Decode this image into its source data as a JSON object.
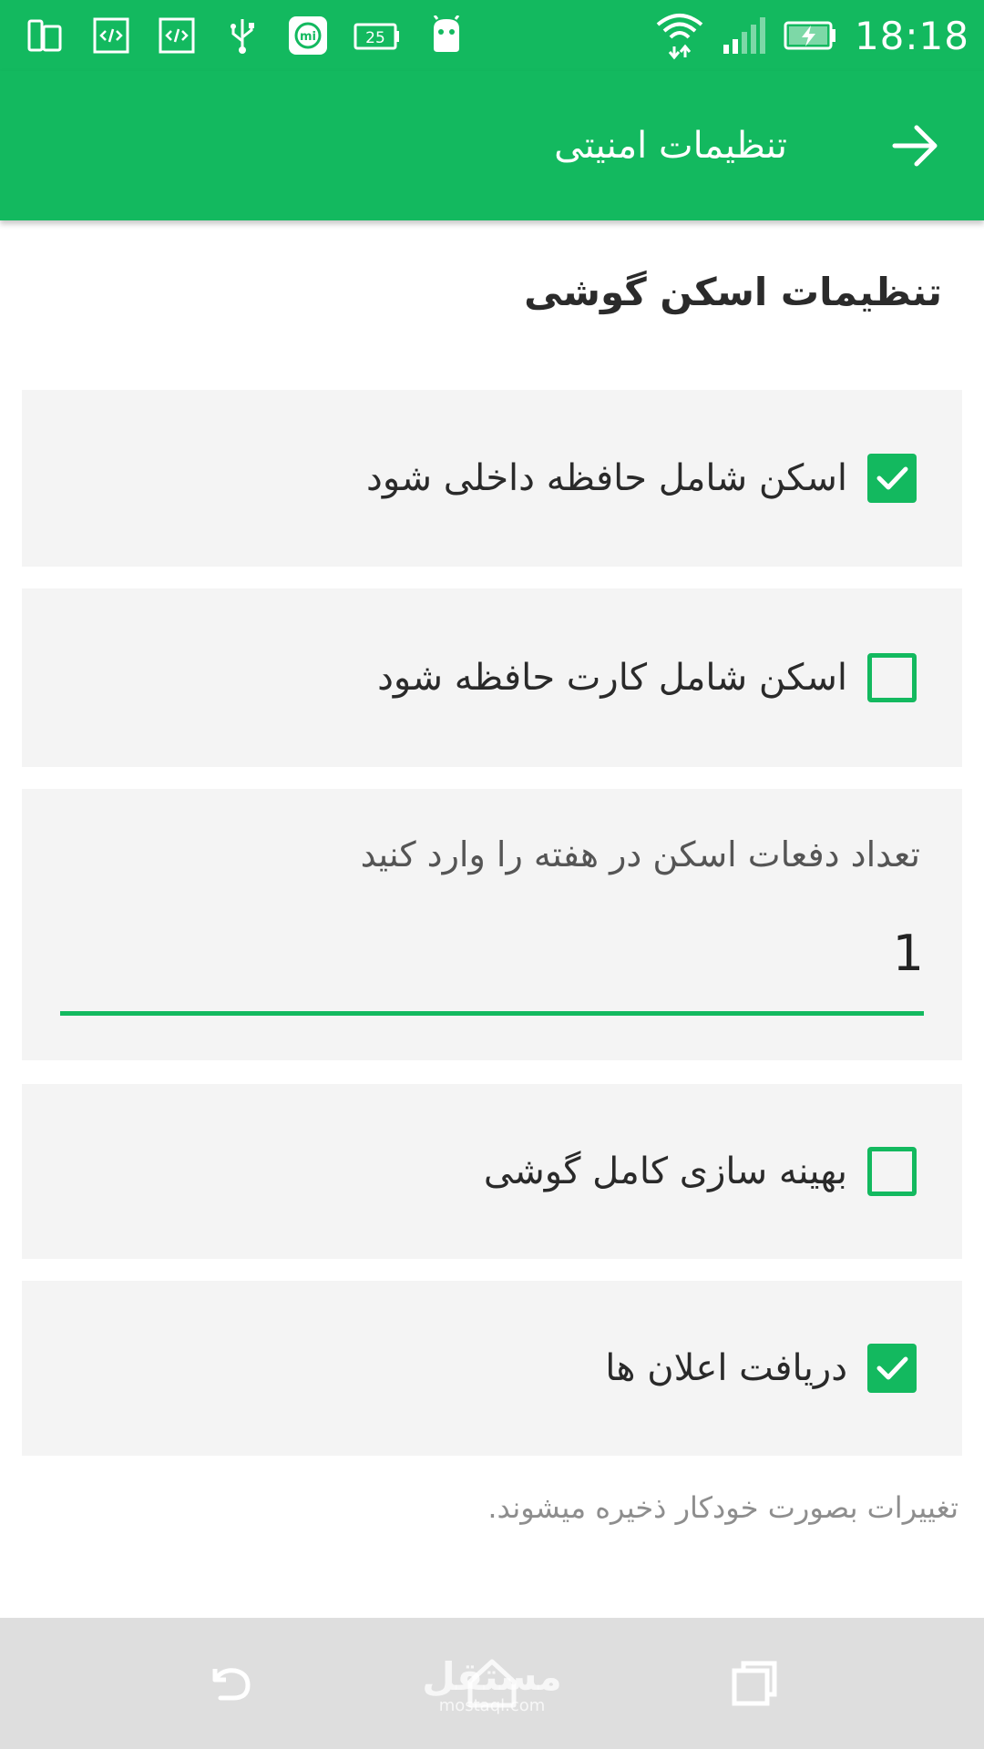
{
  "status_bar": {
    "time": "18:18",
    "battery_badge": "25",
    "mi_badge": "mi",
    "left_icons": [
      "phone-sync-icon",
      "developer-code-icon",
      "developer-code-icon",
      "usb-icon",
      "mi-icon",
      "battery-25-icon",
      "android-icon"
    ],
    "right_icons": [
      "wifi-icon",
      "signal-icon",
      "battery-charging-icon"
    ]
  },
  "app_bar": {
    "title": "تنظیمات امنیتی",
    "back_icon": "arrow-right-icon"
  },
  "section": {
    "title": "تنظیمات اسکن گوشی"
  },
  "settings": {
    "internal_memory": {
      "label": "اسکن شامل حافظه داخلی شود",
      "checked": true
    },
    "memory_card": {
      "label": "اسکن شامل کارت حافظه شود",
      "checked": false
    },
    "scan_count": {
      "label": "تعداد دفعات اسکن در هفته را وارد کنید",
      "value": "1"
    },
    "full_optimization": {
      "label": "بهینه سازی کامل گوشی",
      "checked": false
    },
    "notifications": {
      "label": "دریافت اعلان ها",
      "checked": true
    }
  },
  "footer": {
    "note": "تغییرات بصورت خودکار ذخیره میشوند."
  },
  "nav_bar": {
    "icons": [
      "back-icon",
      "home-icon",
      "recents-icon"
    ]
  },
  "watermark": {
    "main": "مستقل",
    "sub": "mostaql.com"
  },
  "colors": {
    "accent": "#13b95f",
    "card_bg": "#f4f4f4",
    "nav_bg": "#dedede"
  }
}
